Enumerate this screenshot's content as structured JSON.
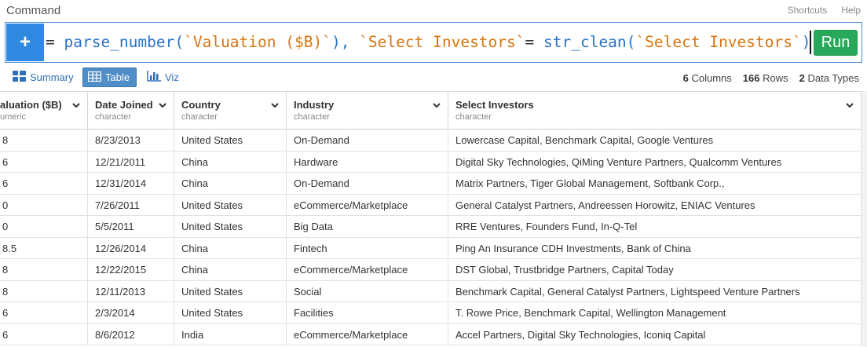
{
  "window": {
    "title": "Command",
    "links": [
      "Shortcuts",
      "Help"
    ]
  },
  "command": {
    "plus_label": "+",
    "segments": [
      {
        "text": "= ",
        "kind": "op"
      },
      {
        "text": "parse_number(",
        "kind": "fn"
      },
      {
        "text": "`Valuation ($B)`",
        "kind": "str"
      },
      {
        "text": "), ",
        "kind": "fn"
      },
      {
        "text": "`Select Investors`",
        "kind": "str"
      },
      {
        "text": "= ",
        "kind": "op"
      },
      {
        "text": "str_clean(",
        "kind": "fn"
      },
      {
        "text": "`Select Investors`",
        "kind": "str"
      },
      {
        "text": "))",
        "kind": "fn"
      }
    ],
    "run_label": "Run"
  },
  "views": [
    {
      "label": "Summary",
      "icon": "summary-icon",
      "active": false
    },
    {
      "label": "Table",
      "icon": "table-icon",
      "active": true
    },
    {
      "label": "Viz",
      "icon": "chart-icon",
      "active": false
    }
  ],
  "stats": {
    "columns_count": "6",
    "columns_label": "Columns",
    "rows_count": "166",
    "rows_label": "Rows",
    "types_count": "2",
    "types_label": "Data Types"
  },
  "columns": [
    {
      "name": "aluation ($B)",
      "type": "umeric"
    },
    {
      "name": "Date Joined",
      "type": "character"
    },
    {
      "name": "Country",
      "type": "character"
    },
    {
      "name": "Industry",
      "type": "character"
    },
    {
      "name": "Select Investors",
      "type": "character"
    }
  ],
  "rows": [
    [
      "8",
      "8/23/2013",
      "United States",
      "On-Demand",
      "Lowercase Capital, Benchmark Capital, Google Ventures"
    ],
    [
      "6",
      "12/21/2011",
      "China",
      "Hardware",
      "Digital Sky Technologies, QiMing Venture Partners, Qualcomm Ventures"
    ],
    [
      "6",
      "12/31/2014",
      "China",
      "On-Demand",
      "Matrix Partners, Tiger Global Management, Softbank Corp.,"
    ],
    [
      "0",
      "7/26/2011",
      "United States",
      "eCommerce/Marketplace",
      "General Catalyst Partners, Andreessen Horowitz, ENIAC Ventures"
    ],
    [
      "0",
      "5/5/2011",
      "United States",
      "Big Data",
      "RRE Ventures, Founders Fund, In-Q-Tel"
    ],
    [
      "8.5",
      "12/26/2014",
      "China",
      "Fintech",
      "Ping An Insurance CDH Investments, Bank of China"
    ],
    [
      "8",
      "12/22/2015",
      "China",
      "eCommerce/Marketplace",
      "DST Global, Trustbridge Partners, Capital Today"
    ],
    [
      "8",
      "12/11/2013",
      "United States",
      "Social",
      "Benchmark Capital, General Catalyst Partners, Lightspeed Venture Partners"
    ],
    [
      "6",
      "2/3/2014",
      "United States",
      "Facilities",
      "T. Rowe Price, Benchmark Capital, Wellington Management"
    ],
    [
      "6",
      "8/6/2012",
      "India",
      "eCommerce/Marketplace",
      "Accel Partners, Digital Sky Technologies, Iconiq Capital"
    ]
  ],
  "colors": {
    "accent": "#2f89e0",
    "run": "#28a85a",
    "fn": "#2873c9",
    "str": "#d8750f"
  }
}
